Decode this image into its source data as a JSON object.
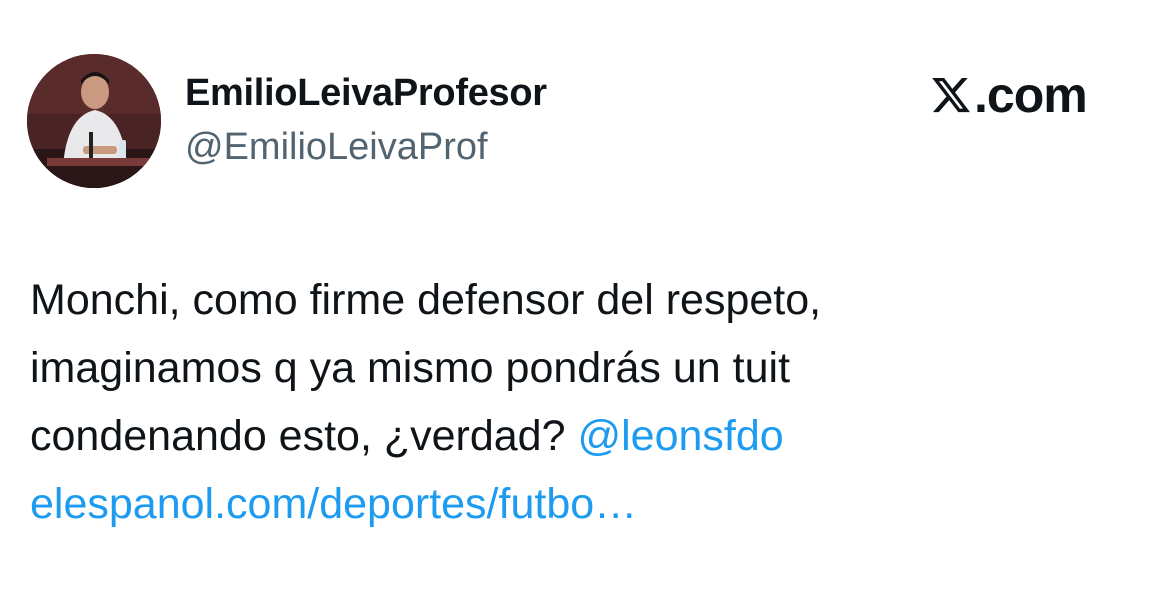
{
  "header": {
    "display_name": "EmilioLeivaProfesor",
    "handle": "@EmilioLeivaProf",
    "avatar_icon": "profile-photo",
    "brand_icon": "x-logo-icon",
    "brand_text": ".com"
  },
  "tweet": {
    "line1": "Monchi, como firme defensor del respeto,",
    "line2": "imaginamos q ya mismo pondrás un tuit",
    "line3": "condenando esto, ¿verdad? ",
    "mention": "@leonsfdo",
    "link": "elespanol.com/deportes/futbo…"
  },
  "colors": {
    "text": "#0f1419",
    "secondary": "#536471",
    "link": "#1d9bf0",
    "background": "#ffffff"
  }
}
